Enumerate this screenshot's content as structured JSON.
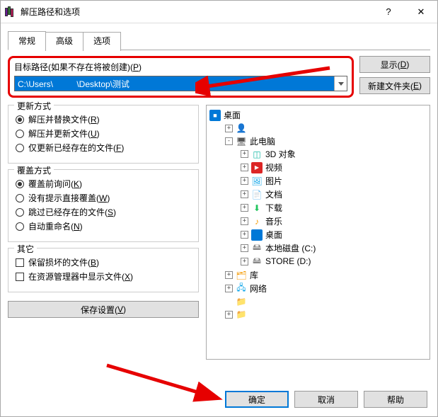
{
  "titlebar": {
    "title": "解压路径和选项"
  },
  "tabs": {
    "general": "常规",
    "advanced": "高级",
    "options": "选项"
  },
  "path": {
    "label_prefix": "目标路径(如果不存在将被创建)(",
    "label_hotkey": "P",
    "label_suffix": ")",
    "value": "C:\\Users\\          \\Desktop\\测试"
  },
  "buttons": {
    "display_prefix": "显示(",
    "display_hotkey": "D",
    "display_suffix": ")",
    "newfolder_prefix": "新建文件夹(",
    "newfolder_hotkey": "E",
    "newfolder_suffix": ")",
    "save_prefix": "保存设置(",
    "save_hotkey": "V",
    "save_suffix": ")",
    "ok": "确定",
    "cancel": "取消",
    "help": "帮助"
  },
  "groups": {
    "update": {
      "legend": "更新方式",
      "opt1_prefix": "解压并替换文件(",
      "opt1_hk": "R",
      "opt1_suffix": ")",
      "opt2_prefix": "解压并更新文件(",
      "opt2_hk": "U",
      "opt2_suffix": ")",
      "opt3_prefix": "仅更新已经存在的文件(",
      "opt3_hk": "F",
      "opt3_suffix": ")"
    },
    "overwrite": {
      "legend": "覆盖方式",
      "opt1_prefix": "覆盖前询问(",
      "opt1_hk": "K",
      "opt1_suffix": ")",
      "opt2_prefix": "没有提示直接覆盖(",
      "opt2_hk": "W",
      "opt2_suffix": ")",
      "opt3_prefix": "跳过已经存在的文件(",
      "opt3_hk": "S",
      "opt3_suffix": ")",
      "opt4_prefix": "自动重命名(",
      "opt4_hk": "N",
      "opt4_suffix": ")"
    },
    "other": {
      "legend": "其它",
      "chk1_prefix": "保留损坏的文件(",
      "chk1_hk": "B",
      "chk1_suffix": ")",
      "chk2_prefix": "在资源管理器中显示文件(",
      "chk2_hk": "X",
      "chk2_suffix": ")"
    }
  },
  "tree": {
    "root": "桌面",
    "user": "",
    "thispc": "此电脑",
    "items": {
      "obj3d": "3D 对象",
      "video": "视频",
      "pic": "图片",
      "doc": "文档",
      "down": "下载",
      "music": "音乐",
      "desk": "桌面",
      "cdrive": "本地磁盘 (C:)",
      "ddrive": "STORE (D:)"
    },
    "lib": "库",
    "net": "网络",
    "f1": "",
    "f2": ""
  }
}
